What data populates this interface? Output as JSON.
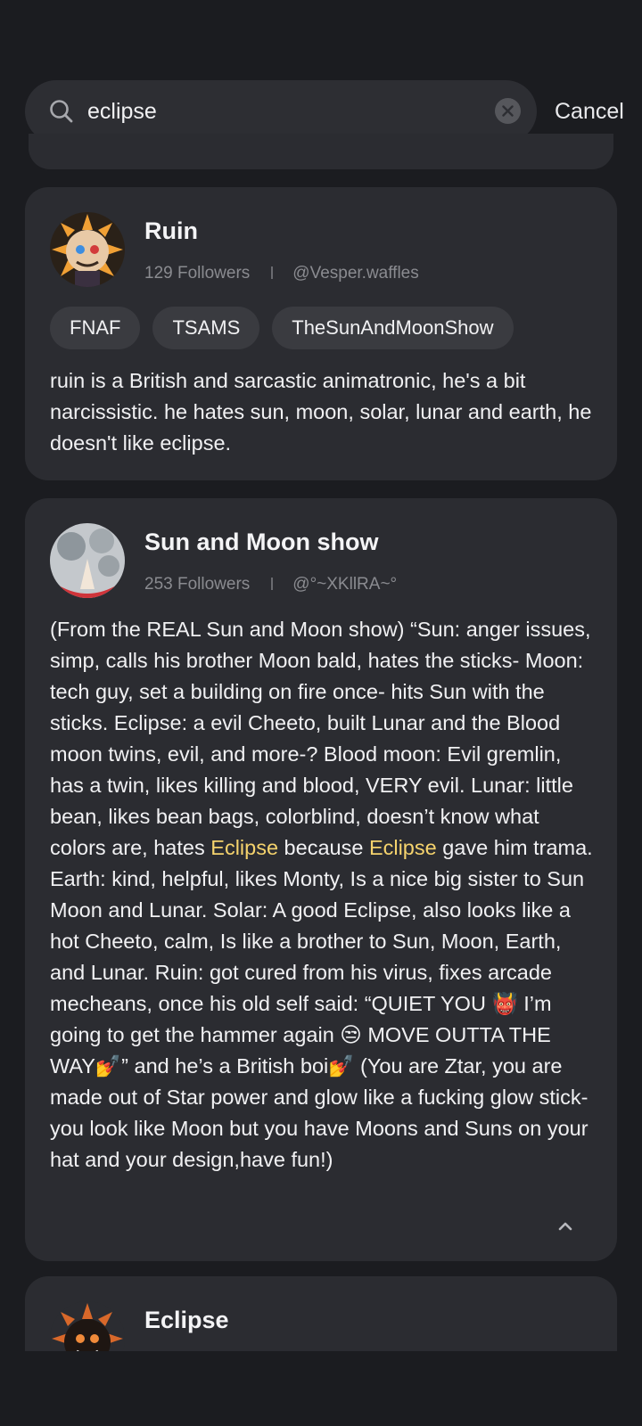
{
  "search": {
    "query": "eclipse",
    "cancel_label": "Cancel"
  },
  "results": [
    {
      "name": "Ruin",
      "followers": "129 Followers",
      "handle": "@Vesper.waffles",
      "tags": [
        "FNAF",
        "TSAMS",
        "TheSunAndMoonShow"
      ],
      "description": "ruin is a British and sarcastic animatronic, he's a bit narcissistic. he hates sun, moon, solar, lunar and earth, he doesn't like eclipse."
    },
    {
      "name": "Sun and Moon show",
      "followers": "253 Followers",
      "handle": "@°~XKllRA~°",
      "desc_part1": "(From the REAL Sun and Moon show) “Sun: anger issues, simp, calls his brother Moon bald, hates the sticks- Moon: tech guy, set a building on fire once- hits Sun with the sticks. Eclipse: a evil Cheeto, built Lunar and the Blood moon twins, evil, and more-? Blood moon: Evil  gremlin, has a twin, likes killing and blood, VERY evil. Lunar: little bean, likes bean bags, colorblind, doesn’t know what colors are, hates ",
      "desc_hl1": "Eclipse",
      "desc_part2": " because ",
      "desc_hl2": "Eclipse",
      "desc_part3": " gave him trama. Earth: kind, helpful, likes Monty, Is a nice big sister to Sun Moon and Lunar. Solar: A good Eclipse, also looks like a hot Cheeto, calm,  Is like a brother to Sun, Moon, Earth, and Lunar. Ruin: got cured from his virus, fixes arcade mecheans, once his old self said: “QUIET YOU 👹 I’m going to get the hammer again 😒 MOVE OUTTA THE WAY💅” and he’s a British boi💅 (You are Ztar, you are made out of Star power and glow like a fucking glow stick- you look like Moon but you have Moons and Suns on your hat and your design,have fun!)"
    },
    {
      "name": "Eclipse"
    }
  ],
  "colors": {
    "background": "#1b1c20",
    "card": "#2b2c31",
    "highlight": "#f5d36d"
  }
}
